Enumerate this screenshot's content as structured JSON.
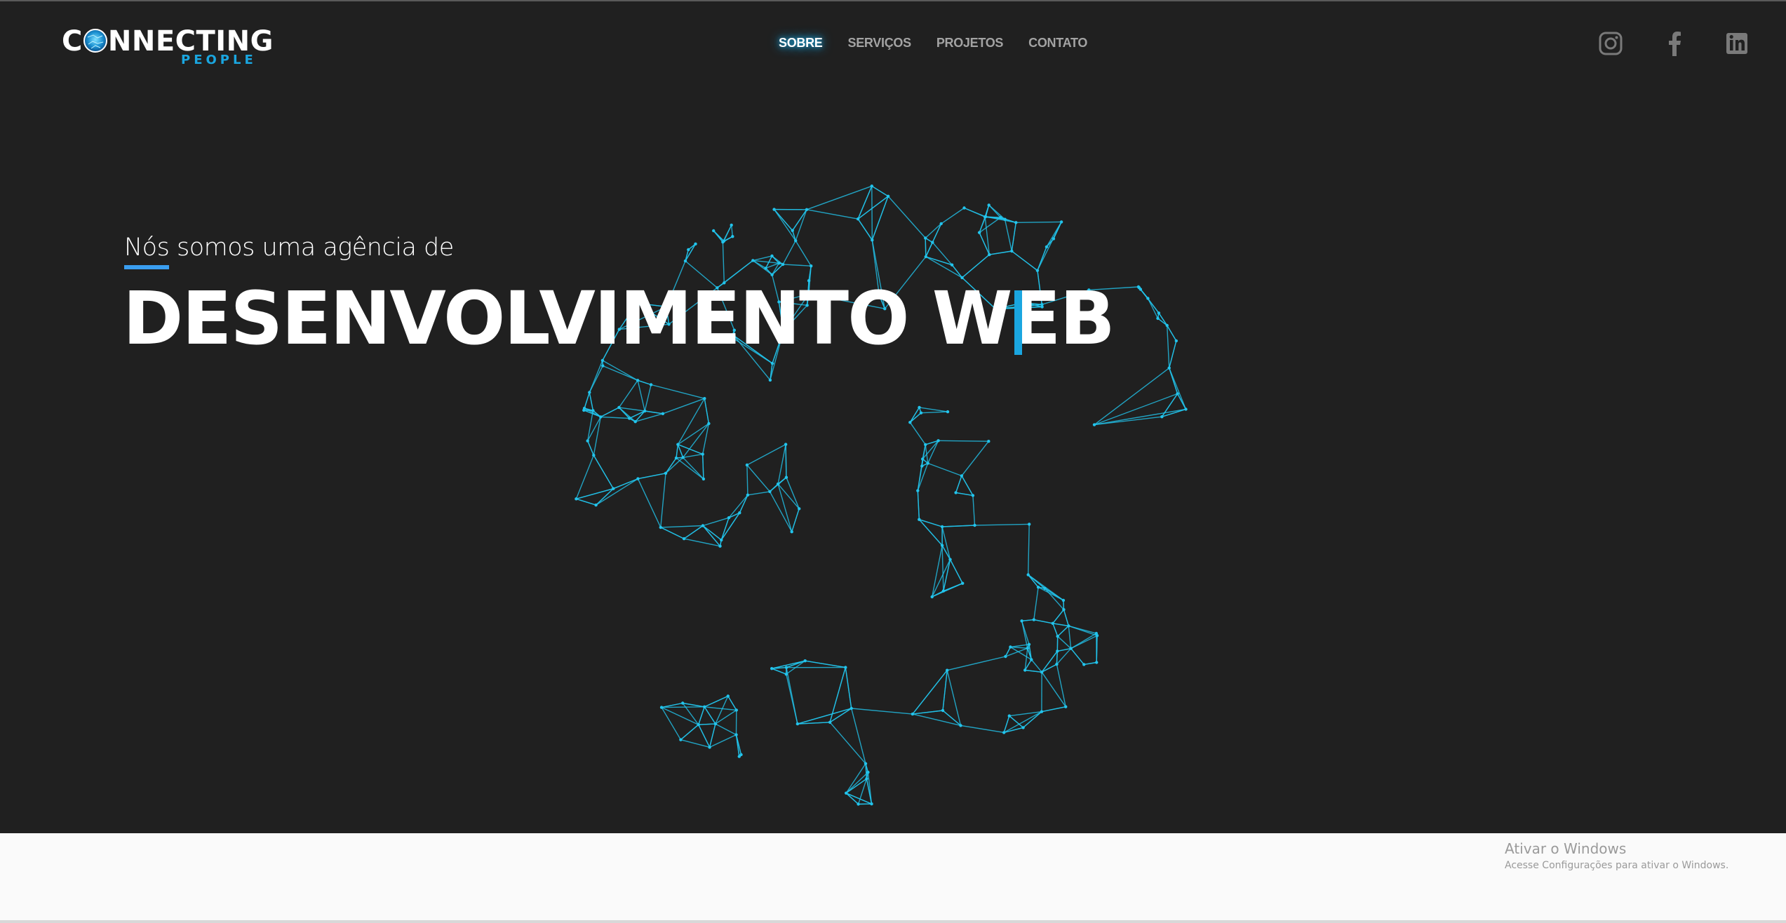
{
  "header": {
    "logo": {
      "main": "CONNECTING",
      "sub": "PEOPLE"
    },
    "nav": [
      {
        "label": "SOBRE",
        "active": true
      },
      {
        "label": "SERVIÇOS",
        "active": false
      },
      {
        "label": "PROJETOS",
        "active": false
      },
      {
        "label": "CONTATO",
        "active": false
      }
    ],
    "social": [
      {
        "name": "instagram-icon"
      },
      {
        "name": "facebook-icon"
      },
      {
        "name": "linkedin-icon"
      }
    ]
  },
  "hero": {
    "intro": "Nós somos uma agência de",
    "headline": "DESENVOLVIMENTO WEB"
  },
  "watermark": {
    "title": "Ativar o Windows",
    "subtitle": "Acesse Configurações para ativar o Windows."
  },
  "colors": {
    "background": "#202020",
    "accent": "#1aa6e0",
    "network": "#22c4ec",
    "nav_inactive": "#a3a3a3",
    "icon": "#7a7a7a"
  }
}
